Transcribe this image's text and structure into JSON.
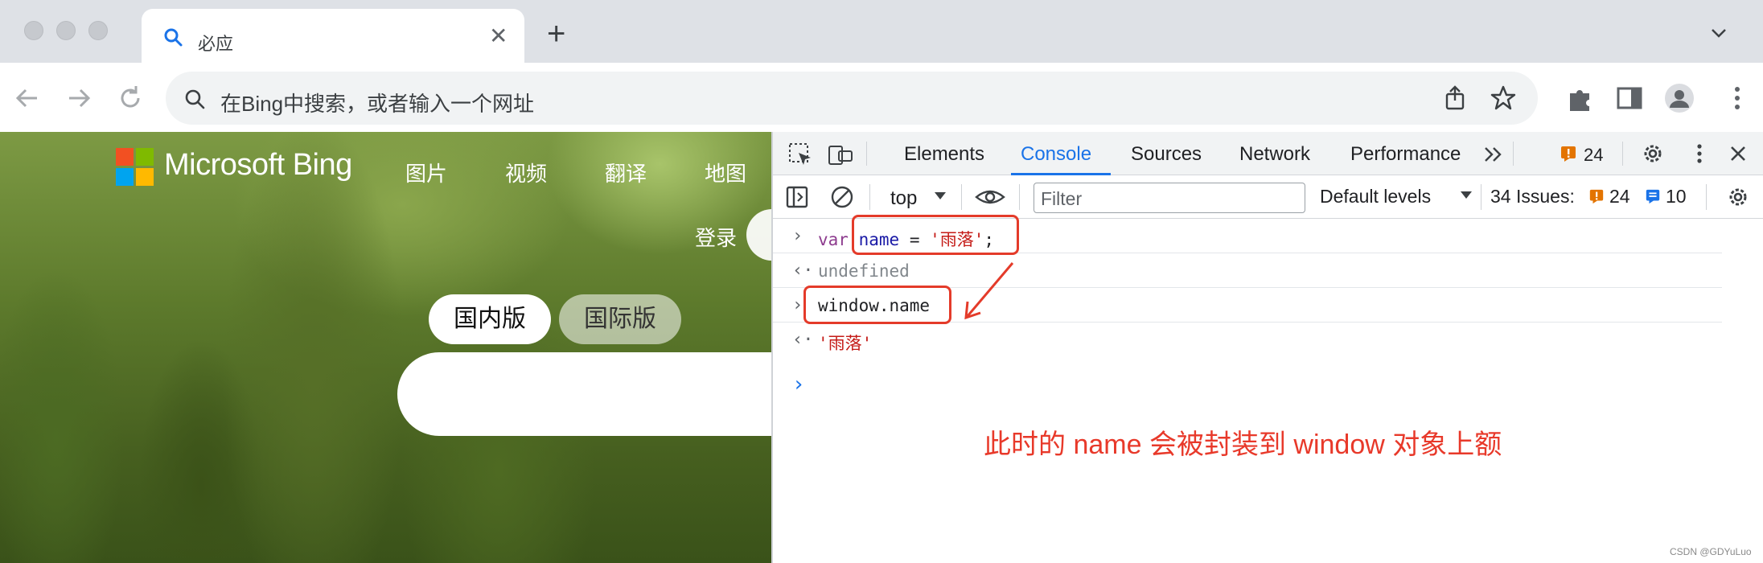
{
  "browser": {
    "tab": {
      "title": "必应"
    },
    "address": {
      "placeholder": "在Bing中搜索，或者输入一个网址"
    }
  },
  "bing": {
    "brand": "Microsoft Bing",
    "nav": [
      "图片",
      "视频",
      "翻译",
      "地图"
    ],
    "login": "登录",
    "region_tabs": [
      "国内版",
      "国际版"
    ]
  },
  "devtools": {
    "tabs": [
      "Elements",
      "Console",
      "Sources",
      "Network",
      "Performance"
    ],
    "active_tab": "Console",
    "warning_count": "24",
    "context": "top",
    "filter_placeholder": "Filter",
    "levels": "Default levels",
    "issues_label": "34 Issues:",
    "issues_warn": "24",
    "issues_info": "10",
    "colors": {
      "accent": "#1a73e8",
      "annotation": "#e43b2a",
      "warning": "#e37400"
    }
  },
  "console": {
    "line1": {
      "keyword": "var",
      "name": "name",
      "op": " = ",
      "value": "'雨落'",
      "end": ";"
    },
    "line2": "undefined",
    "line3": "window.name",
    "line4": "'雨落'",
    "annotation": "此时的 name 会被封装到 window 对象上额"
  },
  "watermark": "CSDN @GDYuLuo"
}
